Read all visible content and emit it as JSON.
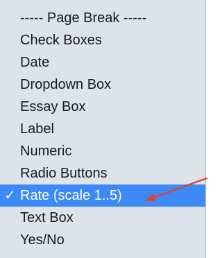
{
  "menu": {
    "items": [
      {
        "label": "----- Page Break -----",
        "selected": false
      },
      {
        "label": "Check Boxes",
        "selected": false
      },
      {
        "label": "Date",
        "selected": false
      },
      {
        "label": "Dropdown Box",
        "selected": false
      },
      {
        "label": "Essay Box",
        "selected": false
      },
      {
        "label": "Label",
        "selected": false
      },
      {
        "label": "Numeric",
        "selected": false
      },
      {
        "label": "Radio Buttons",
        "selected": false
      },
      {
        "label": "Rate (scale 1..5)",
        "selected": true
      },
      {
        "label": "Text Box",
        "selected": false
      },
      {
        "label": "Yes/No",
        "selected": false
      }
    ],
    "checkmark": "✓",
    "selected_bg": "#3d8af7"
  },
  "annotation": {
    "arrow_color": "#d9423a",
    "arrow_icon": "arrow-pointer-icon"
  }
}
